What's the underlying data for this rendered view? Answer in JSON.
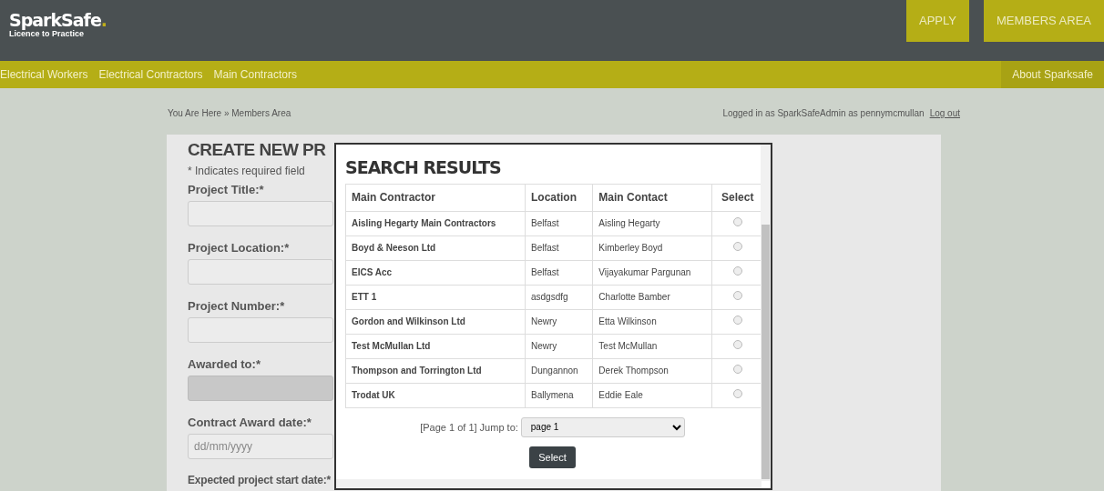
{
  "header": {
    "logo": "SparkSafe",
    "logo_dot": ".",
    "tagline": "Licence to Practice",
    "buttons": [
      {
        "label": "APPLY"
      },
      {
        "label": "MEMBERS AREA"
      }
    ]
  },
  "nav": {
    "items": [
      {
        "label": "Electrical Workers"
      },
      {
        "label": "Electrical Contractors"
      },
      {
        "label": "Main Contractors"
      }
    ],
    "right_item": "About Sparksafe"
  },
  "breadcrumb": "You Are Here » Members Area",
  "login": {
    "text": "Logged in as SparkSafeAdmin as pennymcmullan",
    "link": "Log out"
  },
  "form": {
    "title": "CREATE NEW PR",
    "note": "* Indicates required field",
    "fields": [
      {
        "label": "Project Title:*",
        "disabled": false
      },
      {
        "label": "Project Location:*",
        "disabled": false
      },
      {
        "label": "Project Number:*",
        "disabled": false
      },
      {
        "label": "Awarded to:*",
        "disabled": true
      },
      {
        "label": "Contract Award date:*",
        "disabled": false,
        "placeholder": "dd/mm/yyyy"
      }
    ],
    "next_label": "Expected project start date:*"
  },
  "modal": {
    "title": "SEARCH RESULTS",
    "columns": [
      "Main Contractor",
      "Location",
      "Main Contact",
      "Select"
    ],
    "rows": [
      {
        "contractor": "Aisling Hegarty Main Contractors",
        "location": "Belfast",
        "contact": "Aisling Hegarty",
        "selected": false
      },
      {
        "contractor": "Boyd & Neeson Ltd",
        "location": "Belfast",
        "contact": "Kimberley Boyd",
        "selected": false
      },
      {
        "contractor": "EICS Acc",
        "location": "Belfast",
        "contact": "Vijayakumar Pargunan",
        "selected": false
      },
      {
        "contractor": "ETT 1",
        "location": "asdgsdfg",
        "contact": "Charlotte Bamber",
        "selected": false
      },
      {
        "contractor": "Gordon and Wilkinson Ltd",
        "location": "Newry",
        "contact": "Etta Wilkinson",
        "selected": false
      },
      {
        "contractor": "Test McMullan Ltd",
        "location": "Newry",
        "contact": "Test McMullan",
        "selected": false
      },
      {
        "contractor": "Thompson and Torrington Ltd",
        "location": "Dungannon",
        "contact": "Derek Thompson",
        "selected": false
      },
      {
        "contractor": "Trodat UK",
        "location": "Ballymena",
        "contact": "Eddie Eale",
        "selected": false
      }
    ],
    "pager": "[Page 1 of 1] Jump to:",
    "page_select": "page 1",
    "button": "Select"
  }
}
